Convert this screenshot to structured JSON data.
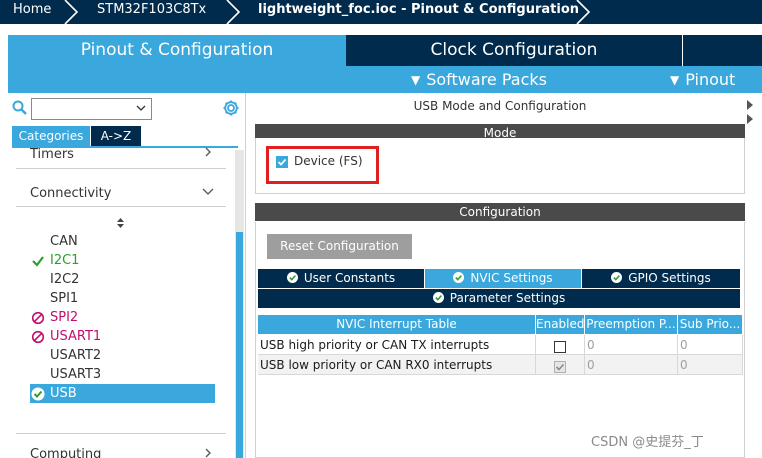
{
  "breadcrumb": {
    "items": [
      "Home",
      "STM32F103C8Tx",
      "lightweight_foc.ioc - Pinout & Configuration"
    ]
  },
  "main_tabs": [
    {
      "label": "Pinout & Configuration",
      "active": true
    },
    {
      "label": "Clock Configuration",
      "active": false
    }
  ],
  "sub_tabs": {
    "software_packs": "Software Packs",
    "pinout": "Pinout"
  },
  "left": {
    "search_value": "",
    "categories_tab": "Categories",
    "az_tab": "A->Z",
    "groups": {
      "timers": "Timers",
      "connectivity": "Connectivity",
      "computing": "Computing"
    },
    "peripherals": [
      {
        "label": "CAN",
        "status": "none"
      },
      {
        "label": "I2C1",
        "status": "ok"
      },
      {
        "label": "I2C2",
        "status": "none"
      },
      {
        "label": "SPI1",
        "status": "none"
      },
      {
        "label": "SPI2",
        "status": "disabled"
      },
      {
        "label": "USART1",
        "status": "disabled"
      },
      {
        "label": "USART2",
        "status": "none"
      },
      {
        "label": "USART3",
        "status": "none"
      },
      {
        "label": "USB",
        "status": "ok-selected"
      }
    ]
  },
  "right": {
    "title": "USB Mode and Configuration",
    "mode_header": "Mode",
    "device_label": "Device (FS)",
    "device_checked": true,
    "configuration_header": "Configuration",
    "reset_button": "Reset Configuration",
    "config_tabs": [
      "User Constants",
      "NVIC Settings",
      "GPIO Settings",
      "Parameter Settings"
    ],
    "active_config_tab": "NVIC Settings",
    "nvic_table": {
      "headers": [
        "NVIC Interrupt Table",
        "Enabled",
        "Preemption P...",
        "Sub Prio..."
      ],
      "rows": [
        {
          "name": "USB high priority or CAN TX interrupts",
          "enabled": false,
          "preemption": "0",
          "sub": "0"
        },
        {
          "name": "USB low priority or CAN RX0 interrupts",
          "enabled": true,
          "preemption": "0",
          "sub": "0"
        }
      ]
    }
  },
  "watermark": "CSDN @史提芬_丁",
  "colors": {
    "navy": "#002b4d",
    "accent": "#3aa8dc",
    "ok_green": "#2aa12a",
    "disabled_magenta": "#c0106e",
    "highlight_red": "#e02020"
  }
}
